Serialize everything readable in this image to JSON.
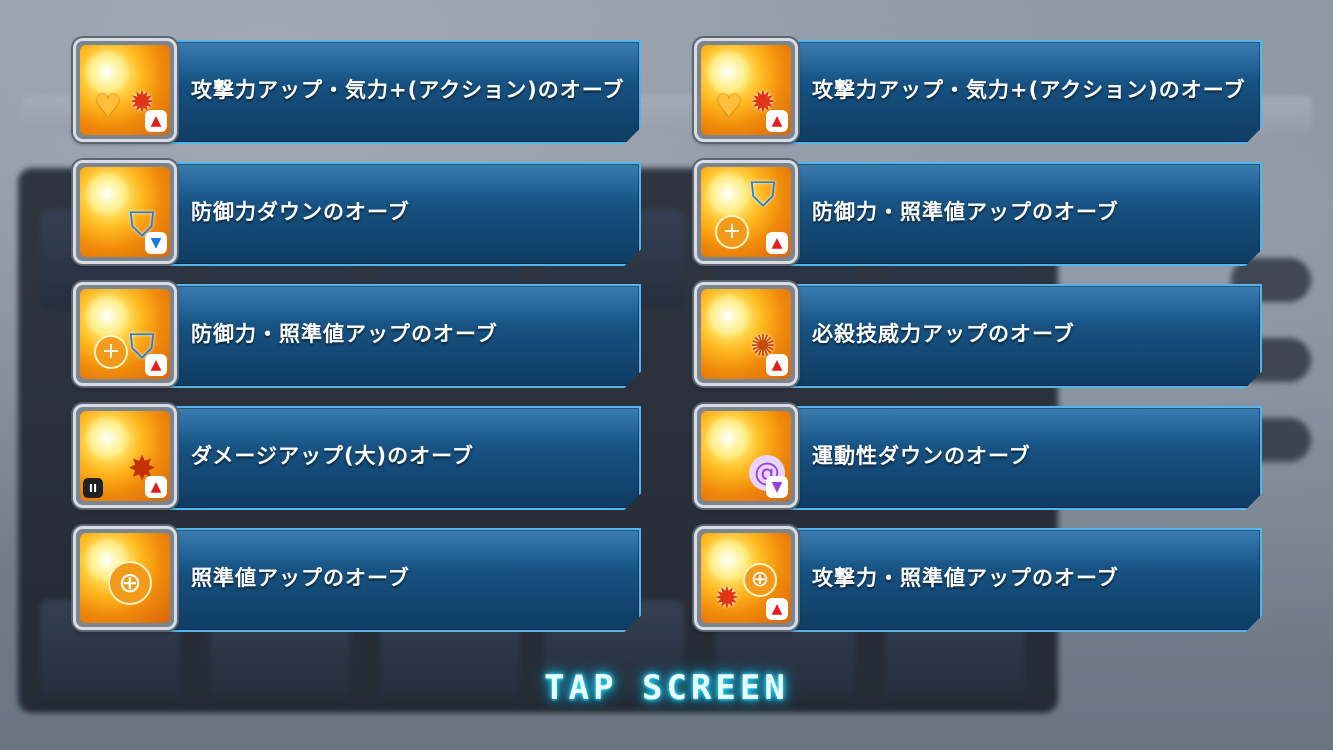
{
  "orbs": [
    {
      "label": "攻撃力アップ・気力+(アクション)のオーブ",
      "icon": "attack-up-energy-orb-icon",
      "symbol": "✹",
      "symbol2": "♥",
      "effect": "up"
    },
    {
      "label": "攻撃力アップ・気力+(アクション)のオーブ",
      "icon": "attack-up-energy-orb-icon",
      "symbol": "✹",
      "symbol2": "♥",
      "effect": "up"
    },
    {
      "label": "防御力ダウンのオーブ",
      "icon": "defense-down-orb-icon",
      "symbol": "⛉",
      "effect": "down"
    },
    {
      "label": "防御力・照準値アップのオーブ",
      "icon": "defense-aim-up-orb-icon",
      "symbol": "⛉",
      "effect": "up"
    },
    {
      "label": "防御力・照準値アップのオーブ",
      "icon": "defense-aim-up-orb-icon",
      "symbol": "⛉",
      "effect": "up"
    },
    {
      "label": "必殺技威力アップのオーブ",
      "icon": "special-power-up-orb-icon",
      "symbol": "✺",
      "effect": "up"
    },
    {
      "label": "ダメージアップ(大)のオーブ",
      "icon": "damage-up-large-orb-icon",
      "symbol": "✸",
      "effect": "up",
      "tier": "II"
    },
    {
      "label": "運動性ダウンのオーブ",
      "icon": "mobility-down-orb-icon",
      "symbol": "@",
      "effect": "down"
    },
    {
      "label": "照準値アップのオーブ",
      "icon": "aim-up-orb-icon",
      "symbol": "⊕",
      "effect": "up"
    },
    {
      "label": "攻撃力・照準値アップのオーブ",
      "icon": "attack-aim-up-orb-icon",
      "symbol": "⊕",
      "symbol2": "✹",
      "effect": "up"
    }
  ],
  "tap_screen": "TAP SCREEN",
  "colors": {
    "bar_top": "#1f6aa6",
    "bar_bottom": "#0f3c63",
    "bar_border": "#4fb6ee",
    "up_arrow": "#e51d1d",
    "down_arrow": "#1b79e6",
    "glow": "#34e6ff"
  }
}
